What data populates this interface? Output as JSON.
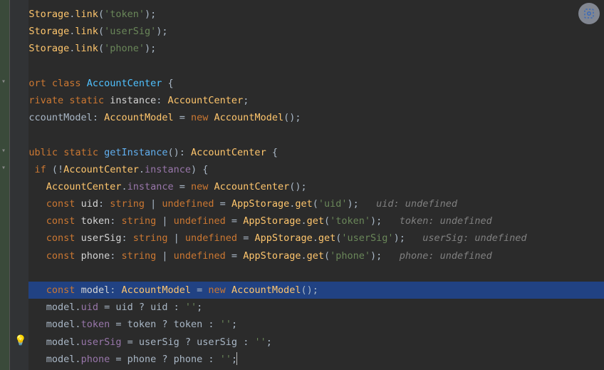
{
  "icons": {
    "screenshot": "screenshot"
  },
  "gutter": {
    "bulb": "💡",
    "fold_down": "▾",
    "fold_right": "▸"
  },
  "lines": [
    {
      "tokens": [
        {
          "c": "c-type",
          "t": "AppStorage"
        },
        {
          "c": "c-dot",
          "t": "."
        },
        {
          "c": "c-method",
          "t": "link"
        },
        {
          "c": "c-op",
          "t": "("
        },
        {
          "c": "c-string",
          "t": "'token'"
        },
        {
          "c": "c-op",
          "t": ");"
        }
      ]
    },
    {
      "tokens": [
        {
          "c": "c-type",
          "t": "AppStorage"
        },
        {
          "c": "c-dot",
          "t": "."
        },
        {
          "c": "c-method",
          "t": "link"
        },
        {
          "c": "c-op",
          "t": "("
        },
        {
          "c": "c-string",
          "t": "'userSig'"
        },
        {
          "c": "c-op",
          "t": ");"
        }
      ]
    },
    {
      "tokens": [
        {
          "c": "c-type",
          "t": "AppStorage"
        },
        {
          "c": "c-dot",
          "t": "."
        },
        {
          "c": "c-method",
          "t": "link"
        },
        {
          "c": "c-op",
          "t": "("
        },
        {
          "c": "c-string",
          "t": "'phone'"
        },
        {
          "c": "c-op",
          "t": ");"
        }
      ]
    },
    {
      "tokens": []
    },
    {
      "tokens": [
        {
          "c": "c-keyword",
          "t": "export"
        },
        {
          "c": "c-default",
          "t": " "
        },
        {
          "c": "c-keyword",
          "t": "class"
        },
        {
          "c": "c-default",
          "t": " "
        },
        {
          "c": "c-class",
          "t": "AccountCenter"
        },
        {
          "c": "c-default",
          "t": " "
        },
        {
          "c": "c-op",
          "t": "{"
        }
      ]
    },
    {
      "indent": 1,
      "tokens": [
        {
          "c": "c-keyword",
          "t": "private"
        },
        {
          "c": "c-default",
          "t": " "
        },
        {
          "c": "c-keyword",
          "t": "static"
        },
        {
          "c": "c-default",
          "t": " "
        },
        {
          "c": "c-white",
          "t": "instance"
        },
        {
          "c": "c-op",
          "t": ": "
        },
        {
          "c": "c-type",
          "t": "AccountCenter"
        },
        {
          "c": "c-op",
          "t": ";"
        }
      ]
    },
    {
      "indent": 1,
      "tokens": [
        {
          "c": "c-default",
          "t": "accountModel"
        },
        {
          "c": "c-op",
          "t": ": "
        },
        {
          "c": "c-type",
          "t": "AccountModel"
        },
        {
          "c": "c-op",
          "t": " = "
        },
        {
          "c": "c-keyword",
          "t": "new"
        },
        {
          "c": "c-default",
          "t": " "
        },
        {
          "c": "c-type",
          "t": "AccountModel"
        },
        {
          "c": "c-op",
          "t": "();"
        }
      ]
    },
    {
      "indent": 1,
      "tokens": []
    },
    {
      "indent": 1,
      "tokens": [
        {
          "c": "c-keyword",
          "t": "public"
        },
        {
          "c": "c-default",
          "t": " "
        },
        {
          "c": "c-keyword",
          "t": "static"
        },
        {
          "c": "c-default",
          "t": " "
        },
        {
          "c": "c-methodc",
          "t": "getInstance"
        },
        {
          "c": "c-op",
          "t": "(): "
        },
        {
          "c": "c-type",
          "t": "AccountCenter"
        },
        {
          "c": "c-op",
          "t": " {"
        }
      ]
    },
    {
      "indent": 2,
      "tokens": [
        {
          "c": "c-keyword",
          "t": "if"
        },
        {
          "c": "c-op",
          "t": " (!"
        },
        {
          "c": "c-type",
          "t": "AccountCenter"
        },
        {
          "c": "c-op",
          "t": "."
        },
        {
          "c": "c-purple",
          "t": "instance"
        },
        {
          "c": "c-op",
          "t": ") {"
        }
      ]
    },
    {
      "indent": 3,
      "tokens": [
        {
          "c": "c-type",
          "t": "AccountCenter"
        },
        {
          "c": "c-op",
          "t": "."
        },
        {
          "c": "c-purple",
          "t": "instance"
        },
        {
          "c": "c-op",
          "t": " = "
        },
        {
          "c": "c-keyword",
          "t": "new"
        },
        {
          "c": "c-default",
          "t": " "
        },
        {
          "c": "c-type",
          "t": "AccountCenter"
        },
        {
          "c": "c-op",
          "t": "();"
        }
      ]
    },
    {
      "indent": 3,
      "tokens": [
        {
          "c": "c-keyword",
          "t": "const"
        },
        {
          "c": "c-default",
          "t": " "
        },
        {
          "c": "c-white",
          "t": "uid"
        },
        {
          "c": "c-op",
          "t": ": "
        },
        {
          "c": "c-keyword",
          "t": "string"
        },
        {
          "c": "c-op",
          "t": " | "
        },
        {
          "c": "c-keyword",
          "t": "undefined"
        },
        {
          "c": "c-op",
          "t": " = "
        },
        {
          "c": "c-type",
          "t": "AppStorage"
        },
        {
          "c": "c-op",
          "t": "."
        },
        {
          "c": "c-method",
          "t": "get"
        },
        {
          "c": "c-op",
          "t": "("
        },
        {
          "c": "c-string",
          "t": "'uid'"
        },
        {
          "c": "c-op",
          "t": ");   "
        },
        {
          "c": "c-comment",
          "t": "uid: undefined"
        }
      ]
    },
    {
      "indent": 3,
      "tokens": [
        {
          "c": "c-keyword",
          "t": "const"
        },
        {
          "c": "c-default",
          "t": " "
        },
        {
          "c": "c-white",
          "t": "token"
        },
        {
          "c": "c-op",
          "t": ": "
        },
        {
          "c": "c-keyword",
          "t": "string"
        },
        {
          "c": "c-op",
          "t": " | "
        },
        {
          "c": "c-keyword",
          "t": "undefined"
        },
        {
          "c": "c-op",
          "t": " = "
        },
        {
          "c": "c-type",
          "t": "AppStorage"
        },
        {
          "c": "c-op",
          "t": "."
        },
        {
          "c": "c-method",
          "t": "get"
        },
        {
          "c": "c-op",
          "t": "("
        },
        {
          "c": "c-string",
          "t": "'token'"
        },
        {
          "c": "c-op",
          "t": ");   "
        },
        {
          "c": "c-comment",
          "t": "token: undefined"
        }
      ]
    },
    {
      "indent": 3,
      "tokens": [
        {
          "c": "c-keyword",
          "t": "const"
        },
        {
          "c": "c-default",
          "t": " "
        },
        {
          "c": "c-white",
          "t": "userSig"
        },
        {
          "c": "c-op",
          "t": ": "
        },
        {
          "c": "c-keyword",
          "t": "string"
        },
        {
          "c": "c-op",
          "t": " | "
        },
        {
          "c": "c-keyword",
          "t": "undefined"
        },
        {
          "c": "c-op",
          "t": " = "
        },
        {
          "c": "c-type",
          "t": "AppStorage"
        },
        {
          "c": "c-op",
          "t": "."
        },
        {
          "c": "c-method",
          "t": "get"
        },
        {
          "c": "c-op",
          "t": "("
        },
        {
          "c": "c-string",
          "t": "'userSig'"
        },
        {
          "c": "c-op",
          "t": ");   "
        },
        {
          "c": "c-comment",
          "t": "userSig: undefined"
        }
      ]
    },
    {
      "indent": 3,
      "tokens": [
        {
          "c": "c-keyword",
          "t": "const"
        },
        {
          "c": "c-default",
          "t": " "
        },
        {
          "c": "c-white",
          "t": "phone"
        },
        {
          "c": "c-op",
          "t": ": "
        },
        {
          "c": "c-keyword",
          "t": "string"
        },
        {
          "c": "c-op",
          "t": " | "
        },
        {
          "c": "c-keyword",
          "t": "undefined"
        },
        {
          "c": "c-op",
          "t": " = "
        },
        {
          "c": "c-type",
          "t": "AppStorage"
        },
        {
          "c": "c-op",
          "t": "."
        },
        {
          "c": "c-method",
          "t": "get"
        },
        {
          "c": "c-op",
          "t": "("
        },
        {
          "c": "c-string",
          "t": "'phone'"
        },
        {
          "c": "c-op",
          "t": ");   "
        },
        {
          "c": "c-comment",
          "t": "phone: undefined"
        }
      ]
    },
    {
      "indent": 3,
      "tokens": []
    },
    {
      "indent": 3,
      "highlighted": true,
      "tokens": [
        {
          "c": "c-keyword",
          "t": "const"
        },
        {
          "c": "c-default",
          "t": " "
        },
        {
          "c": "c-white",
          "t": "model"
        },
        {
          "c": "c-op",
          "t": ": "
        },
        {
          "c": "c-type",
          "t": "AccountModel"
        },
        {
          "c": "c-op",
          "t": " = "
        },
        {
          "c": "c-keyword",
          "t": "new"
        },
        {
          "c": "c-default",
          "t": " "
        },
        {
          "c": "c-type",
          "t": "AccountModel"
        },
        {
          "c": "c-op",
          "t": "();"
        }
      ]
    },
    {
      "indent": 3,
      "tokens": [
        {
          "c": "c-default",
          "t": "model."
        },
        {
          "c": "c-purple",
          "t": "uid"
        },
        {
          "c": "c-op",
          "t": " = "
        },
        {
          "c": "c-default",
          "t": "uid "
        },
        {
          "c": "c-op",
          "t": "? "
        },
        {
          "c": "c-default",
          "t": "uid "
        },
        {
          "c": "c-op",
          "t": ": "
        },
        {
          "c": "c-string",
          "t": "''"
        },
        {
          "c": "c-op",
          "t": ";"
        }
      ]
    },
    {
      "indent": 3,
      "tokens": [
        {
          "c": "c-default",
          "t": "model."
        },
        {
          "c": "c-purple",
          "t": "token"
        },
        {
          "c": "c-op",
          "t": " = "
        },
        {
          "c": "c-default",
          "t": "token "
        },
        {
          "c": "c-op",
          "t": "? "
        },
        {
          "c": "c-default",
          "t": "token "
        },
        {
          "c": "c-op",
          "t": ": "
        },
        {
          "c": "c-string",
          "t": "''"
        },
        {
          "c": "c-op",
          "t": ";"
        }
      ]
    },
    {
      "indent": 3,
      "tokens": [
        {
          "c": "c-default",
          "t": "model."
        },
        {
          "c": "c-purple",
          "t": "userSig"
        },
        {
          "c": "c-op",
          "t": " = "
        },
        {
          "c": "c-default",
          "t": "userSig "
        },
        {
          "c": "c-op",
          "t": "? "
        },
        {
          "c": "c-default",
          "t": "userSig "
        },
        {
          "c": "c-op",
          "t": ": "
        },
        {
          "c": "c-string",
          "t": "''"
        },
        {
          "c": "c-op",
          "t": ";"
        }
      ]
    },
    {
      "indent": 3,
      "tokens": [
        {
          "c": "c-default",
          "t": "model."
        },
        {
          "c": "c-purple",
          "t": "phone"
        },
        {
          "c": "c-op",
          "t": " = "
        },
        {
          "c": "c-default",
          "t": "phone "
        },
        {
          "c": "c-op",
          "t": "? "
        },
        {
          "c": "c-default",
          "t": "phone "
        },
        {
          "c": "c-op",
          "t": ": "
        },
        {
          "c": "c-string",
          "t": "''"
        },
        {
          "c": "c-op",
          "t": ";"
        },
        {
          "c": "cursor",
          "t": ""
        }
      ]
    }
  ]
}
